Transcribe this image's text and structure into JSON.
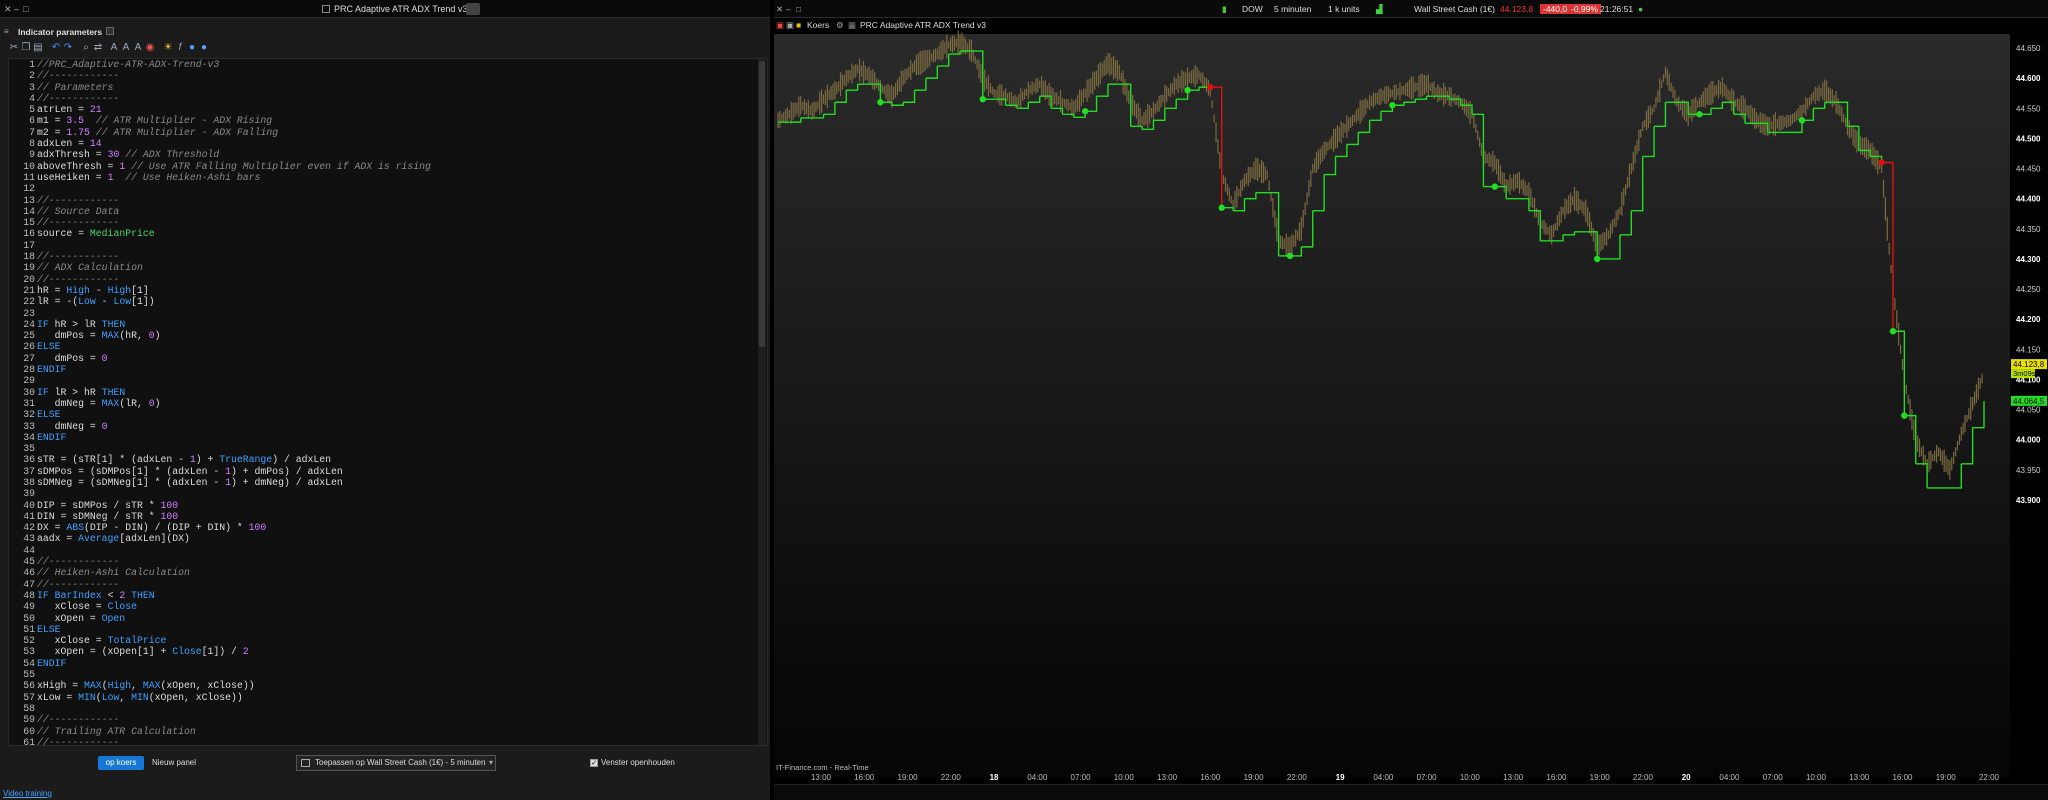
{
  "left_window": {
    "title": "PRC Adaptive ATR ADX Trend v3",
    "panel_title": "Indicator parameters",
    "toolbar_icons": [
      "close-icon",
      "copy-icon",
      "paste-icon",
      "undo-icon",
      "redo-icon",
      "search-icon",
      "replace-icon",
      "text-icon",
      "text-size-icon",
      "text-format-icon",
      "color-icon",
      "light-bulb-icon",
      "function-icon",
      "help-icon",
      "settings-icon"
    ],
    "code_lines": [
      "//PRC_Adaptive-ATR-ADX-Trend-v3",
      "//------------",
      "// Parameters",
      "//------------",
      "atrLen = 21",
      "m1 = 3.5  // ATR Multiplier - ADX Rising",
      "m2 = 1.75 // ATR Multiplier - ADX Falling",
      "adxLen = 14",
      "adxThresh = 30 // ADX Threshold",
      "aboveThresh = 1 // Use ATR Falling Multiplier even if ADX is rising",
      "useHeiken = 1  // Use Heiken-Ashi bars",
      "",
      "//------------",
      "// Source Data",
      "//------------",
      "source = MedianPrice",
      "",
      "//------------",
      "// ADX Calculation",
      "//------------",
      "hR = High - High[1]",
      "lR = -(Low - Low[1])",
      "",
      "IF hR > lR THEN",
      "   dmPos = MAX(hR, 0)",
      "ELSE",
      "   dmPos = 0",
      "ENDIF",
      "",
      "IF lR > hR THEN",
      "   dmNeg = MAX(lR, 0)",
      "ELSE",
      "   dmNeg = 0",
      "ENDIF",
      "",
      "sTR = (sTR[1] * (adxLen - 1) + TrueRange) / adxLen",
      "sDMPos = (sDMPos[1] * (adxLen - 1) + dmPos) / adxLen",
      "sDMNeg = (sDMNeg[1] * (adxLen - 1) + dmNeg) / adxLen",
      "",
      "DIP = sDMPos / sTR * 100",
      "DIN = sDMNeg / sTR * 100",
      "DX = ABS(DIP - DIN) / (DIP + DIN) * 100",
      "aadx = Average[adxLen](DX)",
      "",
      "//------------",
      "// Heiken-Ashi Calculation",
      "//------------",
      "IF BarIndex < 2 THEN",
      "   xClose = Close",
      "   xOpen = Open",
      "ELSE",
      "   xClose = TotalPrice",
      "   xOpen = (xOpen[1] + Close[1]) / 2",
      "ENDIF",
      "",
      "xHigh = MAX(High, MAX(xOpen, xClose))",
      "xLow = MIN(Low, MIN(xOpen, xClose))",
      "",
      "//------------",
      "// Trailing ATR Calculation",
      "//------------"
    ],
    "apply_button": "op koers",
    "new_panel_button": "Nieuw panel",
    "apply_target": "Toepassen op Wall Street Cash (1€) - 5 minuten",
    "keep_open_label": "Venster openhouden",
    "video_link": "Video training"
  },
  "right_window": {
    "toolbar": {
      "instrument_short": "DOW",
      "timeframe": "5 minuten",
      "units": "1 k units",
      "instrument": "Wall Street Cash (1€)",
      "price": "44.123,8",
      "change": "-440,0",
      "change_pct": "-0,99%",
      "time": "21:26:51"
    },
    "price_tab": "Koers",
    "indicator_tab": "PRC Adaptive ATR ADX Trend v3",
    "source_label": "IT-Finance.com - Real-Time",
    "colors": {
      "up": "#22dd22",
      "down": "#e01010",
      "candles": "#7a6a40",
      "price_tag": "#e8e000",
      "trail_tag": "#22dd22"
    }
  },
  "chart_data": {
    "type": "line",
    "title": "",
    "ylim": [
      43850,
      44700
    ],
    "y_ticks": [
      "44.650",
      "44.600",
      "44.550",
      "44.500",
      "44.450",
      "44.400",
      "44.350",
      "44.300",
      "44.250",
      "44.200",
      "44.150",
      "44.100",
      "44.050",
      "44.000",
      "43.950",
      "43.900"
    ],
    "y_tick_values": [
      44650,
      44600,
      44550,
      44500,
      44450,
      44400,
      44350,
      44300,
      44250,
      44200,
      44150,
      44100,
      44050,
      44000,
      43950,
      43900
    ],
    "x_ticks": [
      "13:00",
      "16:00",
      "19:00",
      "22:00",
      "18",
      "04:00",
      "07:00",
      "10:00",
      "13:00",
      "16:00",
      "19:00",
      "22:00",
      "19",
      "04:00",
      "07:00",
      "10:00",
      "13:00",
      "16:00",
      "19:00",
      "22:00",
      "20",
      "04:00",
      "07:00",
      "10:00",
      "13:00",
      "16:00",
      "19:00",
      "22:00"
    ],
    "bold_ticks": [
      "18",
      "19",
      "20"
    ],
    "current_price_label": "44.123,8",
    "countdown_label": "3m09s",
    "trail_price_label": "44.064,5",
    "series": [
      {
        "values": [
          44530,
          44540,
          44555,
          44545,
          44565,
          44580,
          44600,
          44615,
          44605,
          44585,
          44570,
          44600,
          44620,
          44630,
          44640,
          44655,
          44660,
          44645,
          44600,
          44575,
          44570,
          44560,
          44580,
          44590,
          44570,
          44560,
          44550,
          44575,
          44600,
          44625,
          44610,
          44560,
          44530,
          44545,
          44570,
          44590,
          44600,
          44605,
          44580,
          44440,
          44390,
          44430,
          44450,
          44440,
          44330,
          44320,
          44350,
          44450,
          44480,
          44500,
          44520,
          44540,
          44560,
          44570,
          44575,
          44580,
          44585,
          44590,
          44575,
          44570,
          44560,
          44540,
          44470,
          44460,
          44420,
          44430,
          44410,
          44360,
          44340,
          44380,
          44400,
          44380,
          44320,
          44340,
          44380,
          44450,
          44520,
          44550,
          44610,
          44560,
          44540,
          44560,
          44575,
          44585,
          44560,
          44550,
          44530,
          44520,
          44525,
          44530,
          44545,
          44570,
          44580,
          44560,
          44520,
          44490,
          44480,
          44450,
          44250,
          44100,
          44000,
          43960,
          43980,
          43950,
          44010,
          44060,
          44110
        ]
      },
      {
        "values": [
          44527,
          44527,
          44534,
          44534,
          44540,
          44560,
          44580,
          44590,
          44590,
          44560,
          44555,
          44560,
          44580,
          44600,
          44620,
          44640,
          44645,
          44645,
          44565,
          44565,
          44555,
          44550,
          44560,
          44570,
          44550,
          44540,
          44535,
          44545,
          44570,
          44590,
          44590,
          44520,
          44515,
          44530,
          44550,
          44565,
          44580,
          44585,
          44585,
          44385,
          44380,
          44400,
          44410,
          44410,
          44305,
          44305,
          44320,
          44380,
          44440,
          44470,
          44490,
          44510,
          44530,
          44545,
          44555,
          44560,
          44565,
          44570,
          44570,
          44565,
          44555,
          44540,
          44420,
          44420,
          44400,
          44400,
          44380,
          44330,
          44330,
          44340,
          44345,
          44345,
          44300,
          44300,
          44340,
          44380,
          44470,
          44520,
          44560,
          44560,
          44540,
          44540,
          44550,
          44560,
          44540,
          44525,
          44525,
          44510,
          44510,
          44510,
          44530,
          44550,
          44560,
          44560,
          44520,
          44480,
          44470,
          44460,
          44180,
          44040,
          43960,
          43920,
          43920,
          43920,
          43960,
          44020,
          44064
        ]
      }
    ]
  }
}
